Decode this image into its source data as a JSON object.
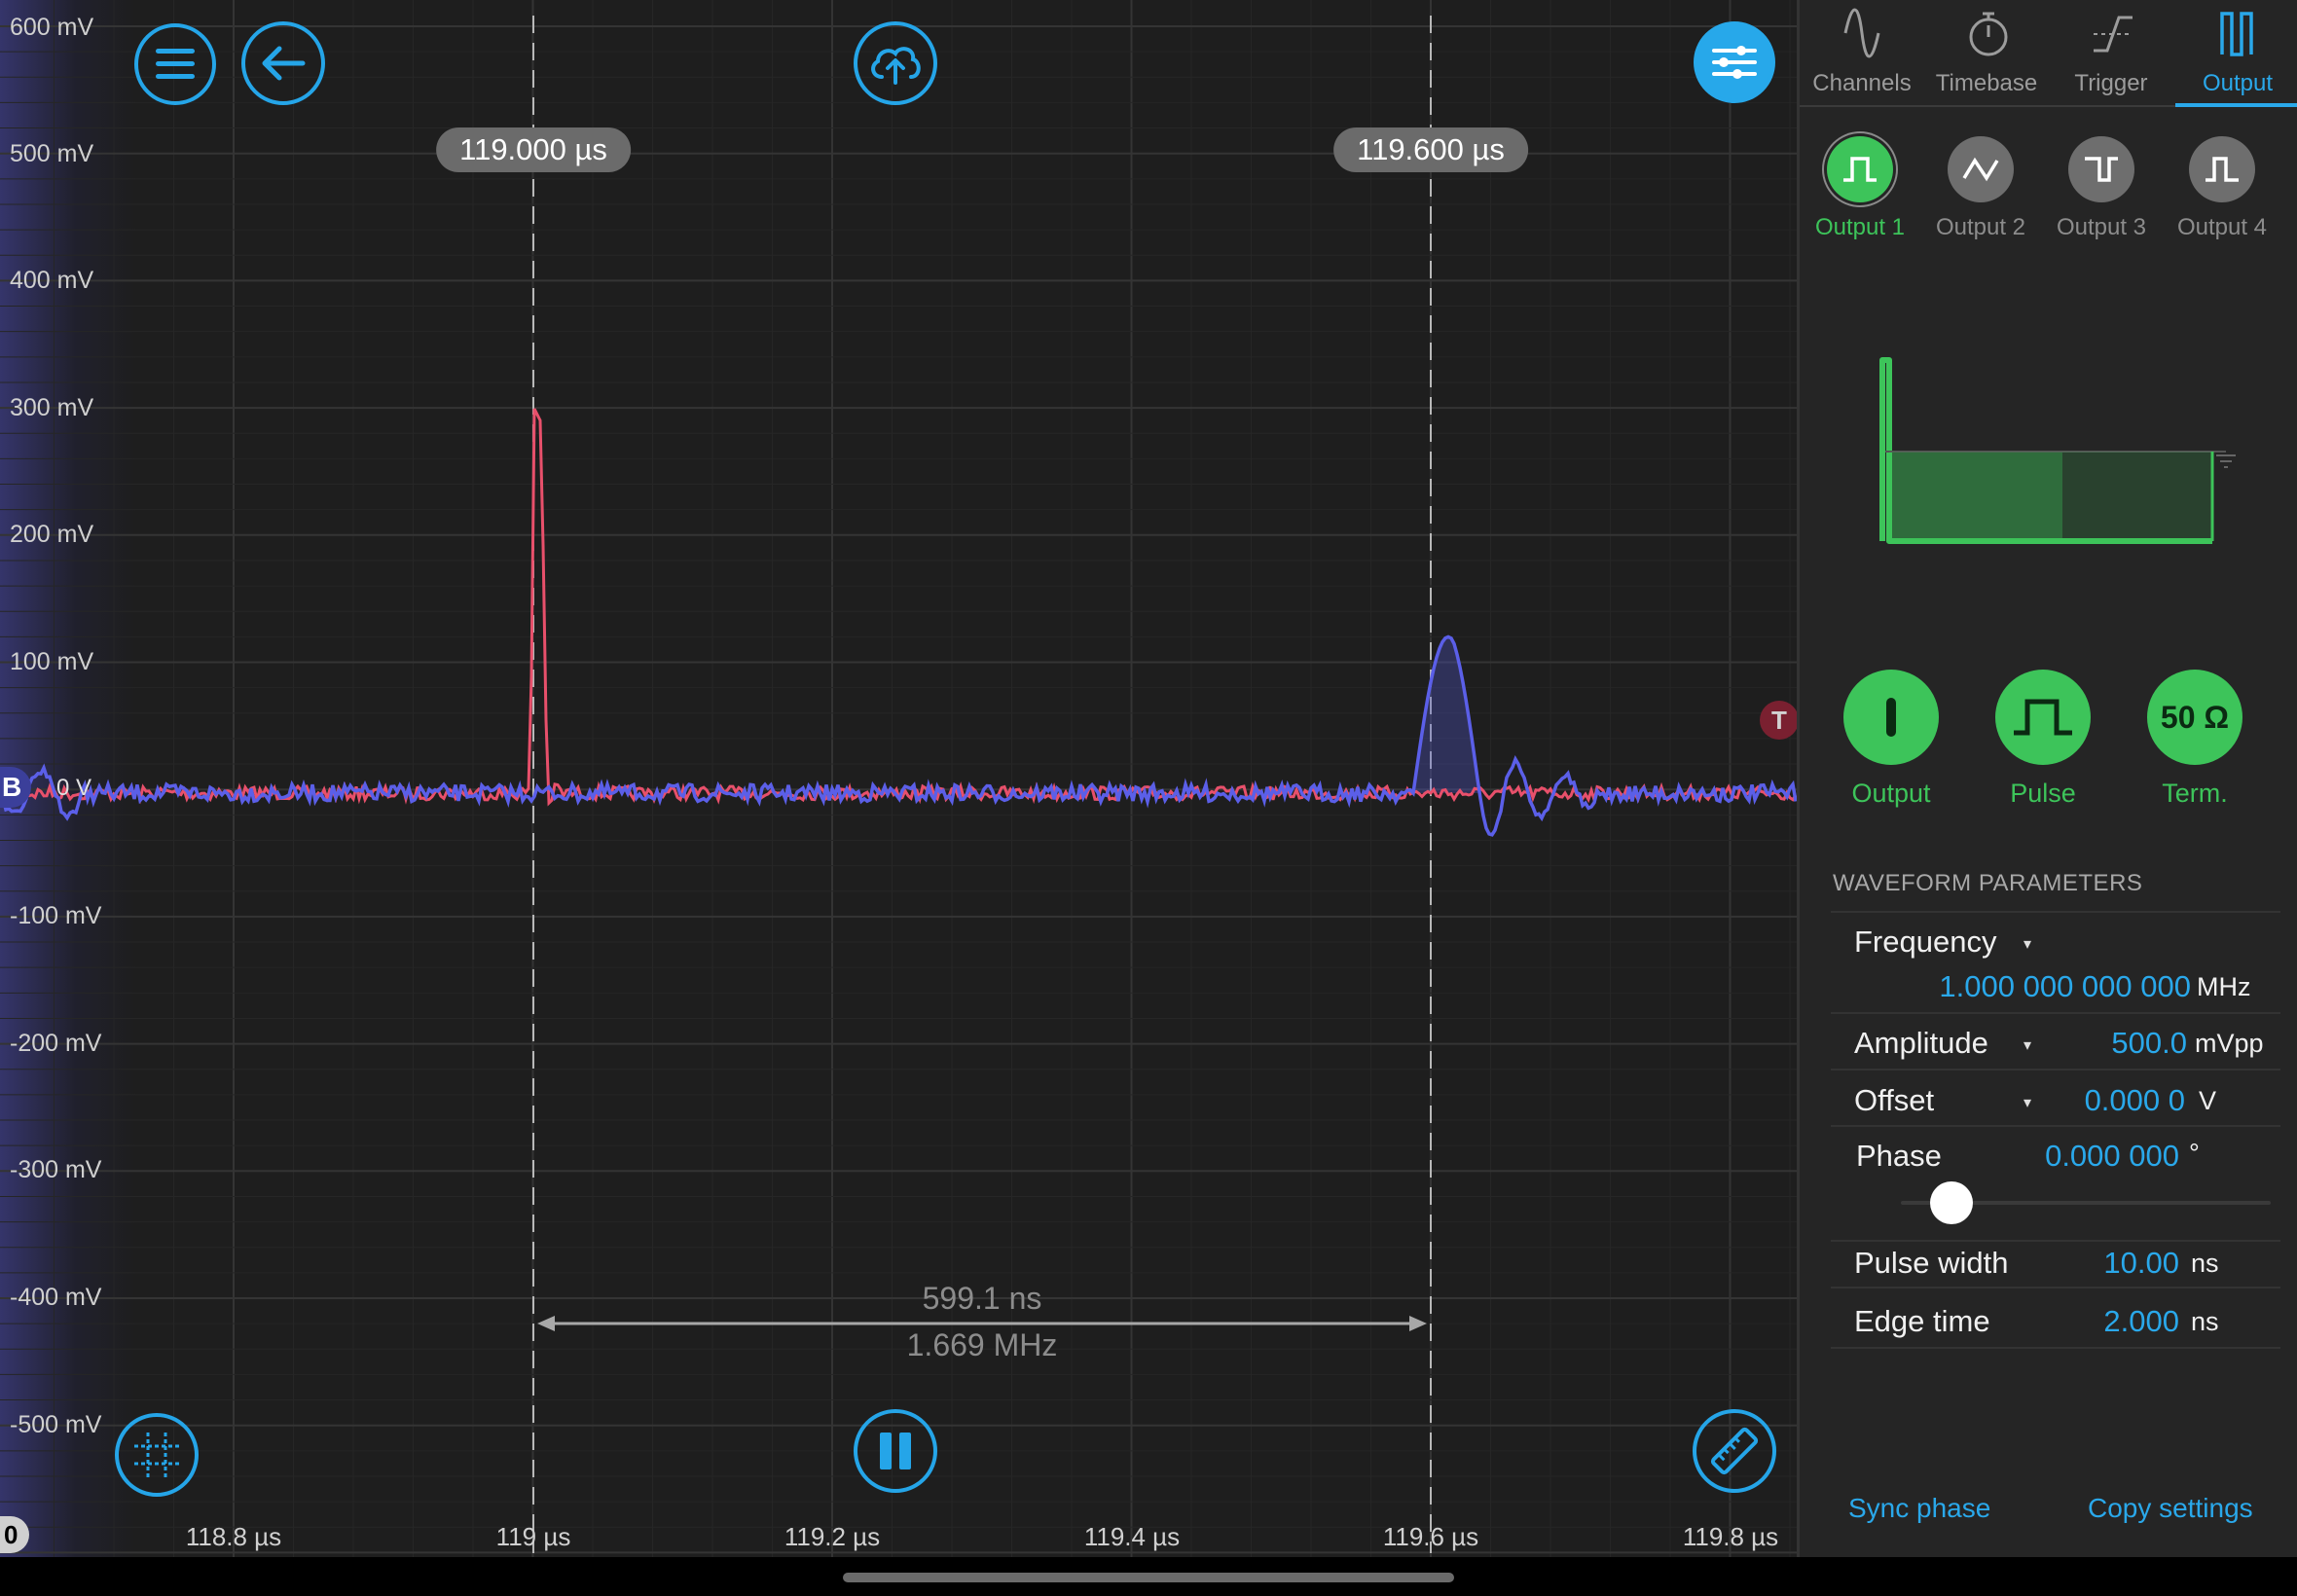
{
  "scope": {
    "y_axis_labels": [
      "600 mV",
      "500 mV",
      "400 mV",
      "300 mV",
      "200 mV",
      "100 mV",
      "0 V",
      "-100 mV",
      "-200 mV",
      "-300 mV",
      "-400 mV",
      "-500 mV"
    ],
    "x_axis_labels": [
      "118.8 µs",
      "119 µs",
      "119.2 µs",
      "119.4 µs",
      "119.6 µs",
      "119.8 µs"
    ],
    "cursor_a_label": "119.000 µs",
    "cursor_b_label": "119.600 µs",
    "delta_time": "599.1 ns",
    "delta_freq": "1.669 MHz",
    "channel_marker": "B",
    "zero_marker": "0",
    "trigger_marker": "T",
    "zero_label": "0 V",
    "colors": {
      "channel_a": "#e8506b",
      "channel_b": "#5b5fe8",
      "accent": "#27a8ea",
      "output_green": "#3dc45a"
    }
  },
  "toolbar": {
    "menu_icon": "hamburger-menu-icon",
    "back_icon": "back-arrow-icon",
    "upload_icon": "cloud-upload-icon",
    "settings_icon": "sliders-icon",
    "grid_icon": "grid-icon",
    "pause_icon": "pause-icon",
    "measure_icon": "ruler-icon"
  },
  "panel": {
    "tabs": [
      {
        "label": "Channels",
        "icon": "sine-wave-icon"
      },
      {
        "label": "Timebase",
        "icon": "stopwatch-icon"
      },
      {
        "label": "Trigger",
        "icon": "trigger-edge-icon"
      },
      {
        "label": "Output",
        "icon": "pulse-output-icon",
        "active": true
      }
    ],
    "outputs": [
      {
        "label": "Output 1",
        "icon": "pulse-icon",
        "active": true
      },
      {
        "label": "Output 2",
        "icon": "sine-icon"
      },
      {
        "label": "Output 3",
        "icon": "square-icon"
      },
      {
        "label": "Output 4",
        "icon": "pulse-icon"
      }
    ],
    "big_buttons": [
      {
        "label": "Output",
        "glyph": "I"
      },
      {
        "label": "Pulse",
        "glyph": ""
      },
      {
        "label": "Term.",
        "glyph": "50 Ω"
      }
    ],
    "section_title": "WAVEFORM PARAMETERS",
    "params": {
      "frequency": {
        "label": "Frequency",
        "value": "1.000 000 000 000",
        "unit": "MHz"
      },
      "amplitude": {
        "label": "Amplitude",
        "value": "500.0",
        "unit": "mVpp"
      },
      "offset": {
        "label": "Offset",
        "value": "0.000 0",
        "unit": "V"
      },
      "phase": {
        "label": "Phase",
        "value": "0.000 000",
        "unit": "°",
        "slider_fraction": 0.0
      },
      "pulse_width": {
        "label": "Pulse width",
        "value": "10.00",
        "unit": "ns"
      },
      "edge_time": {
        "label": "Edge time",
        "value": "2.000",
        "unit": "ns"
      }
    },
    "caret": "▾",
    "sync_phase": "Sync phase",
    "copy_settings": "Copy settings"
  }
}
